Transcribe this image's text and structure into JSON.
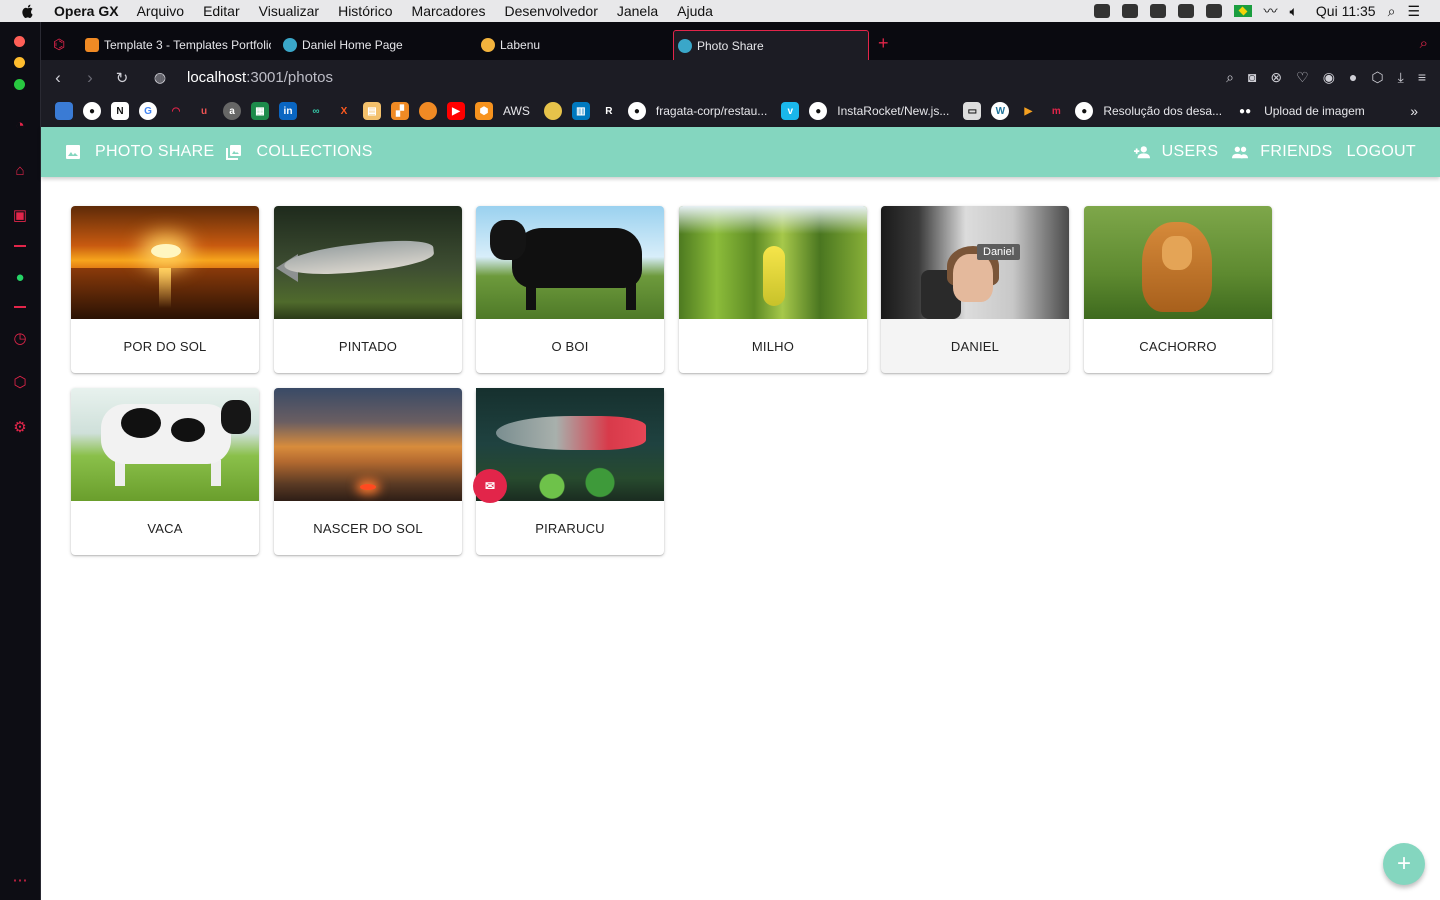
{
  "menubar": {
    "app_name": "Opera GX",
    "items": [
      "Arquivo",
      "Editar",
      "Visualizar",
      "Histórico",
      "Marcadores",
      "Desenvolvedor",
      "Janela",
      "Ajuda"
    ],
    "clock": "Qui 11:35"
  },
  "tabs": [
    {
      "label": "Template 3 - Templates Portfolio",
      "icon": "template-favicon",
      "active": false
    },
    {
      "label": "Daniel Home Page",
      "icon": "react-favicon",
      "active": false
    },
    {
      "label": "Labenu",
      "icon": "labenu-favicon",
      "active": false
    },
    {
      "label": "Photo Share",
      "icon": "react-favicon",
      "active": true
    }
  ],
  "address": {
    "host": "localhost",
    "port_path": ":3001/photos"
  },
  "bookmarks": [
    {
      "label": "",
      "icon": "stack-icon"
    },
    {
      "label": "",
      "icon": "github-icon"
    },
    {
      "label": "",
      "icon": "notion-icon"
    },
    {
      "label": "",
      "icon": "google-icon"
    },
    {
      "label": "",
      "icon": "speedometer-icon"
    },
    {
      "label": "",
      "icon": "udemy-icon"
    },
    {
      "label": "",
      "icon": "amazon-icon"
    },
    {
      "label": "",
      "icon": "sheet-icon"
    },
    {
      "label": "",
      "icon": "linkedin-icon"
    },
    {
      "label": "",
      "icon": "link-icon"
    },
    {
      "label": "",
      "icon": "x-icon"
    },
    {
      "label": "",
      "icon": "calendar-icon"
    },
    {
      "label": "",
      "icon": "grid-icon"
    },
    {
      "label": "",
      "icon": "pill-icon"
    },
    {
      "label": "",
      "icon": "youtube-icon"
    },
    {
      "label": "AWS",
      "icon": "aws-icon"
    },
    {
      "label": "",
      "icon": "cloud-icon"
    },
    {
      "label": "",
      "icon": "trello-icon"
    },
    {
      "label": "",
      "icon": "r-icon"
    },
    {
      "label": "fragata-corp/restau...",
      "icon": "github-icon"
    },
    {
      "label": "",
      "icon": "vimeo-icon"
    },
    {
      "label": "InstaRocket/New.js...",
      "icon": "github-icon"
    },
    {
      "label": "",
      "icon": "terminal-icon"
    },
    {
      "label": "",
      "icon": "wordpress-icon"
    },
    {
      "label": "",
      "icon": "play-icon"
    },
    {
      "label": "",
      "icon": "m-icon"
    },
    {
      "label": "Resolução dos desa...",
      "icon": "github-icon"
    },
    {
      "label": "Upload de imagem",
      "icon": "medium-icon"
    }
  ],
  "appbar": {
    "photo_share": "PHOTO SHARE",
    "collections": "COLLECTIONS",
    "users": "USERS",
    "friends": "FRIENDS",
    "logout": "LOGOUT"
  },
  "photos": [
    {
      "title": "POR DO SOL",
      "scene": "sunset"
    },
    {
      "title": "PINTADO",
      "scene": "fish"
    },
    {
      "title": "O BOI",
      "scene": "ox"
    },
    {
      "title": "MILHO",
      "scene": "corn"
    },
    {
      "title": "DANIEL",
      "scene": "car",
      "tooltip": "Daniel"
    },
    {
      "title": "CACHORRO",
      "scene": "dog"
    },
    {
      "title": "VACA",
      "scene": "cow"
    },
    {
      "title": "NASCER DO SOL",
      "scene": "dawn"
    },
    {
      "title": "PIRARUCU",
      "scene": "arapaima"
    }
  ],
  "fab": {
    "label": "+",
    "icon": "add-icon"
  },
  "colors": {
    "accent": "#84d6bf",
    "opera_red": "#e2254a",
    "browser_dark": "#1c1c24"
  }
}
